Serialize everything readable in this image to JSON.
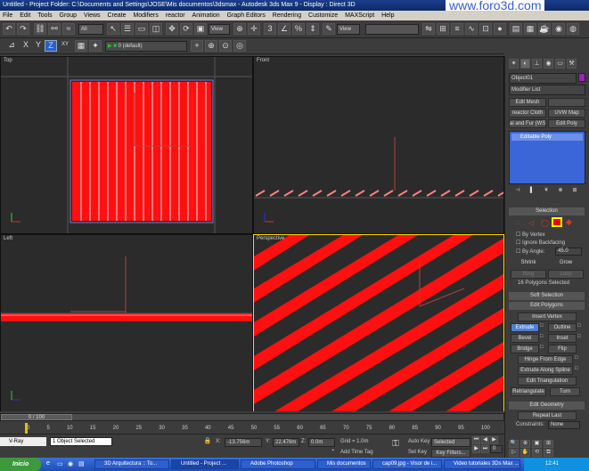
{
  "title": {
    "text": "Untitled    - Project Folder: C:\\Documents and Settings\\JOSE\\Mis documentos\\3dsmax    - Autodesk 3ds Max 9    - Display : Direct 3D",
    "watermark": "www.foro3d.com"
  },
  "menu": [
    "File",
    "Edit",
    "Tools",
    "Group",
    "Views",
    "Create",
    "Modifiers",
    "reactor",
    "Animation",
    "Graph Editors",
    "Rendering",
    "Customize",
    "MAXScript",
    "Help"
  ],
  "toolbar": {
    "selection_filter": "All",
    "ref_coord": "View",
    "ref_coord2": "View"
  },
  "toolbar2": {
    "axes": [
      "X",
      "Y",
      "Z",
      "XY"
    ],
    "layer": "0 (default)"
  },
  "viewports": {
    "top": "Top",
    "front": "Front",
    "left": "Left",
    "perspective": "Perspective"
  },
  "panel": {
    "object_name": "Object01",
    "modifier_list": "Modifier List",
    "mod_buttons": [
      "Edit Mesh",
      "reactor Cloth",
      "UVW Map",
      "ai and Fur (WS",
      "Edit Poly"
    ],
    "stack_item": "Editable Poly",
    "selection_header": "Selection",
    "by_vertex": "By Vertex",
    "ignore_backfacing": "Ignore Backfacing",
    "by_angle": "By Angle:",
    "angle_value": "45.0",
    "shrink": "Shrink",
    "grow": "Grow",
    "ring": "Ring",
    "loop": "Loop",
    "selected_count": "16 Polygons Selected",
    "soft_selection": "Soft Selection",
    "edit_polygons": "Edit Polygons",
    "insert_vertex": "Insert Vertex",
    "extrude": "Extrude",
    "outline": "Outline",
    "bevel": "Bevel",
    "inset": "Inset",
    "bridge": "Bridge",
    "flip": "Flip",
    "hinge": "Hinge From Edge",
    "extrude_spline": "Extrude Along Spline",
    "edit_triangulation": "Edit Triangulation",
    "retriangulate": "Retriangulate",
    "turn": "Turn",
    "edit_geometry": "Edit Geometry",
    "repeat_last": "Repeat Last",
    "constraints": "Constraints:",
    "constraints_val": "None"
  },
  "timeline": {
    "frame": "0 / 100",
    "ticks": [
      "0",
      "5",
      "10",
      "15",
      "20",
      "25",
      "30",
      "35",
      "40",
      "45",
      "50",
      "55",
      "60",
      "65",
      "70",
      "75",
      "80",
      "85",
      "90",
      "95",
      "100"
    ]
  },
  "status": {
    "selected": "1 Object Selected",
    "x_label": "X:",
    "x_val": "-13.756m",
    "y_label": "Y:",
    "y_val": "22.476m",
    "z_label": "Z:",
    "z_val": "0.0m",
    "grid": "Grid = 1.0m",
    "add_time_tag": "Add Time Tag",
    "auto_key": "Auto Key",
    "auto_key_val": "Selected",
    "set_key": "Set Key",
    "key_filters": "Key Filters...",
    "vray": "V-Ray",
    "frame_val": "0"
  },
  "taskbar": {
    "start": "Inicio",
    "tasks": [
      "3D Arquitectura :: To...",
      "Untitled - Project ...",
      "Adobe Photoshop",
      "Mis documentos",
      "cap09.jpg - Visor de i...",
      "Video tutoriales 3Ds Max ..."
    ],
    "clock": "12:41"
  }
}
